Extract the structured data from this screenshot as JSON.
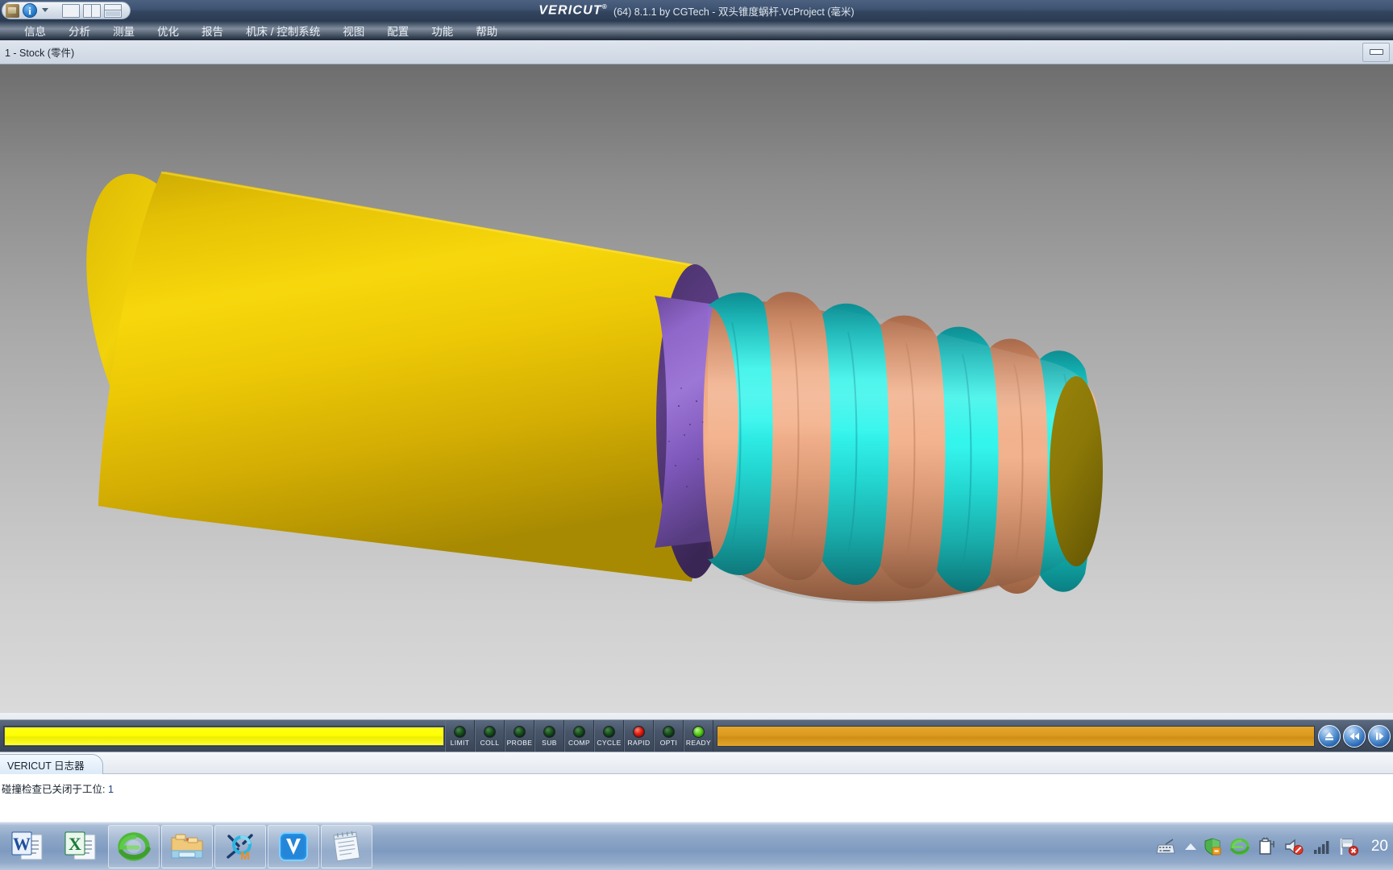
{
  "window": {
    "product": "VERICUT",
    "product_mark": "®",
    "title_suffix": "(64)  8.1.1 by CGTech - 双头锥度蜗杆.VcProject (毫米)",
    "minimize_label": "minimize"
  },
  "toolbar": {
    "app_icon": "vericut-app-icon",
    "info_icon": "info-icon",
    "dropdown_icon": "chevron-down-icon",
    "layout_single": "layout-single-view-button",
    "layout_vertical": "layout-two-vertical-button",
    "layout_horizontal": "layout-two-horizontal-button"
  },
  "menu": {
    "items": [
      {
        "label": "信息"
      },
      {
        "label": "分析"
      },
      {
        "label": "测量"
      },
      {
        "label": "优化"
      },
      {
        "label": "报告"
      },
      {
        "label": "机床 / 控制系统"
      },
      {
        "label": "视图"
      },
      {
        "label": "配置"
      },
      {
        "label": "功能"
      },
      {
        "label": "帮助"
      }
    ]
  },
  "view_header": {
    "label": "1 - Stock (零件)"
  },
  "viewport": {
    "model_name": "双头锥度蜗杆",
    "background_top": "#6d6d6d",
    "background_bottom": "#dadada",
    "colors": {
      "stock_yellow": "#e8c405",
      "stock_yellow_dark": "#b99c03",
      "collar_purple": "#8e63c8",
      "collar_purple_dark": "#4e3470",
      "thread_cyan": "#17e0d8",
      "thread_cyan_dark": "#0aa9a4",
      "thread_salmon": "#e9a17b",
      "thread_salmon_dark": "#c47f5c",
      "end_face_olive": "#8e7c07"
    }
  },
  "statusbar": {
    "progress_percent": 100,
    "leds": [
      {
        "label": "LIMIT",
        "state": "off"
      },
      {
        "label": "COLL",
        "state": "off"
      },
      {
        "label": "PROBE",
        "state": "off"
      },
      {
        "label": "SUB",
        "state": "off"
      },
      {
        "label": "COMP",
        "state": "off"
      },
      {
        "label": "CYCLE",
        "state": "off"
      },
      {
        "label": "RAPID",
        "state": "red"
      },
      {
        "label": "OPTI",
        "state": "off"
      },
      {
        "label": "READY",
        "state": "green"
      }
    ],
    "transport": [
      {
        "name": "reset-button",
        "icon": "eject-icon"
      },
      {
        "name": "rewind-button",
        "icon": "rewind-icon"
      },
      {
        "name": "step-button",
        "icon": "step-icon"
      }
    ]
  },
  "log": {
    "tab_label": "VERICUT 日志器",
    "message_text": "碰撞检查已关闭于工位:",
    "message_value": "1"
  },
  "taskbar": {
    "apps": [
      {
        "name": "word-icon",
        "label": "W",
        "framed": false
      },
      {
        "name": "excel-icon",
        "label": "X",
        "framed": false
      },
      {
        "name": "internet-explorer-icon",
        "label": "e",
        "framed": true
      },
      {
        "name": "file-explorer-icon",
        "label": "folder",
        "framed": true
      },
      {
        "name": "mastercam-icon",
        "label": "M",
        "framed": true
      },
      {
        "name": "vericut-icon",
        "label": "V",
        "framed": true
      },
      {
        "name": "notepad-icon",
        "label": "note",
        "framed": true
      }
    ],
    "tray": [
      {
        "name": "ime-keyboard-icon"
      },
      {
        "name": "show-hidden-icons-icon"
      },
      {
        "name": "security-shield-icon"
      },
      {
        "name": "internet-explorer-tray-icon"
      },
      {
        "name": "battery-icon"
      },
      {
        "name": "volume-muted-icon"
      },
      {
        "name": "network-signal-icon"
      },
      {
        "name": "action-center-flag-icon"
      }
    ],
    "clock": "20"
  }
}
